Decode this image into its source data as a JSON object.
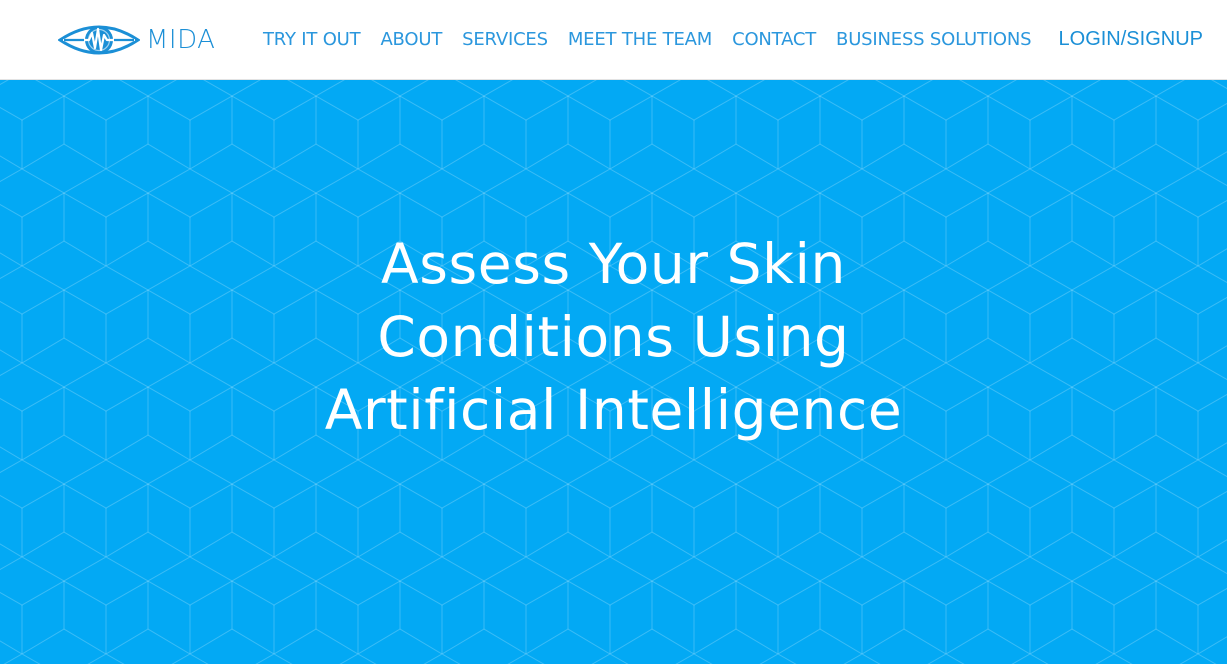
{
  "brand": {
    "name": "MIDA",
    "logo_icon": "eye-heartbeat-icon",
    "color": "#1b8fd6"
  },
  "nav": {
    "items": [
      {
        "label": "TRY IT OUT"
      },
      {
        "label": "ABOUT"
      },
      {
        "label": "SERVICES"
      },
      {
        "label": "MEET THE TEAM"
      },
      {
        "label": "CONTACT"
      },
      {
        "label": "BUSINESS SOLUTIONS"
      }
    ],
    "login_label": "LOGIN/SIGNUP",
    "link_color": "#2b97dd"
  },
  "hero": {
    "title_lines": [
      "Assess Your Skin",
      "Conditions Using",
      "Artificial Intelligence"
    ],
    "background_color": "#03a9f4",
    "pattern": "hexagonal-cube-grid"
  }
}
